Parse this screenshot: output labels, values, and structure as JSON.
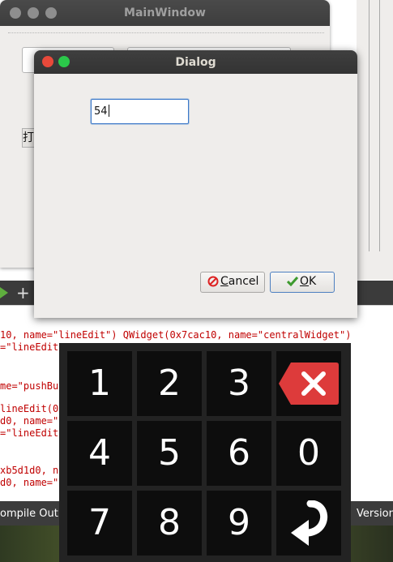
{
  "main_window": {
    "title": "MainWindow",
    "button_partial_label": "打"
  },
  "dialog": {
    "title": "Dialog",
    "input_value": "54",
    "cancel_prefix": "",
    "cancel_accel": "C",
    "cancel_rest": "ancel",
    "ok_accel": "O",
    "ok_rest": "K"
  },
  "ide": {
    "console_lines": [
      "10, name=\"lineEdit\") QWidget(0x7cac10, name=\"centralWidget\")",
      "=\"lineEdit\"",
      "",
      "me=\"pushBut",
      "",
      "lineEdit(0xb",
      "d0, name=\"l",
      "=\"lineEdit\"",
      "",
      "",
      "xb5d1d0, na",
      "d0, name=\"l"
    ],
    "status_left": "ompile Out",
    "status_right": "Version",
    "toolbar_plus": "+"
  },
  "keypad": {
    "keys": [
      "1",
      "2",
      "3",
      "backspace",
      "4",
      "5",
      "6",
      "0",
      "7",
      "8",
      "9",
      "enter"
    ]
  },
  "colors": {
    "close_dot": "#e8493a",
    "min_dot": "#2bc84a",
    "keypad_bg": "#232323",
    "key_bg": "#0d0d0d",
    "backspace_red": "#dd3b3b"
  }
}
